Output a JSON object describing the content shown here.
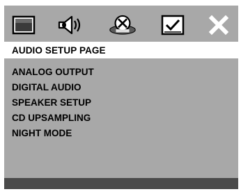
{
  "icons": [
    {
      "name": "general-setup-icon"
    },
    {
      "name": "audio-speaker-icon"
    },
    {
      "name": "video-setup-icon"
    },
    {
      "name": "preference-icon"
    },
    {
      "name": "close-icon"
    }
  ],
  "header": {
    "title": "AUDIO SETUP PAGE"
  },
  "menu": {
    "items": [
      {
        "label": "ANALOG OUTPUT"
      },
      {
        "label": "DIGITAL AUDIO"
      },
      {
        "label": "SPEAKER SETUP"
      },
      {
        "label": "CD UPSAMPLING"
      },
      {
        "label": "NIGHT MODE"
      }
    ]
  },
  "colors": {
    "panel": "#a8a8a8",
    "title_strip": "#ffffff",
    "bottom_bar": "#4a4a4a"
  }
}
